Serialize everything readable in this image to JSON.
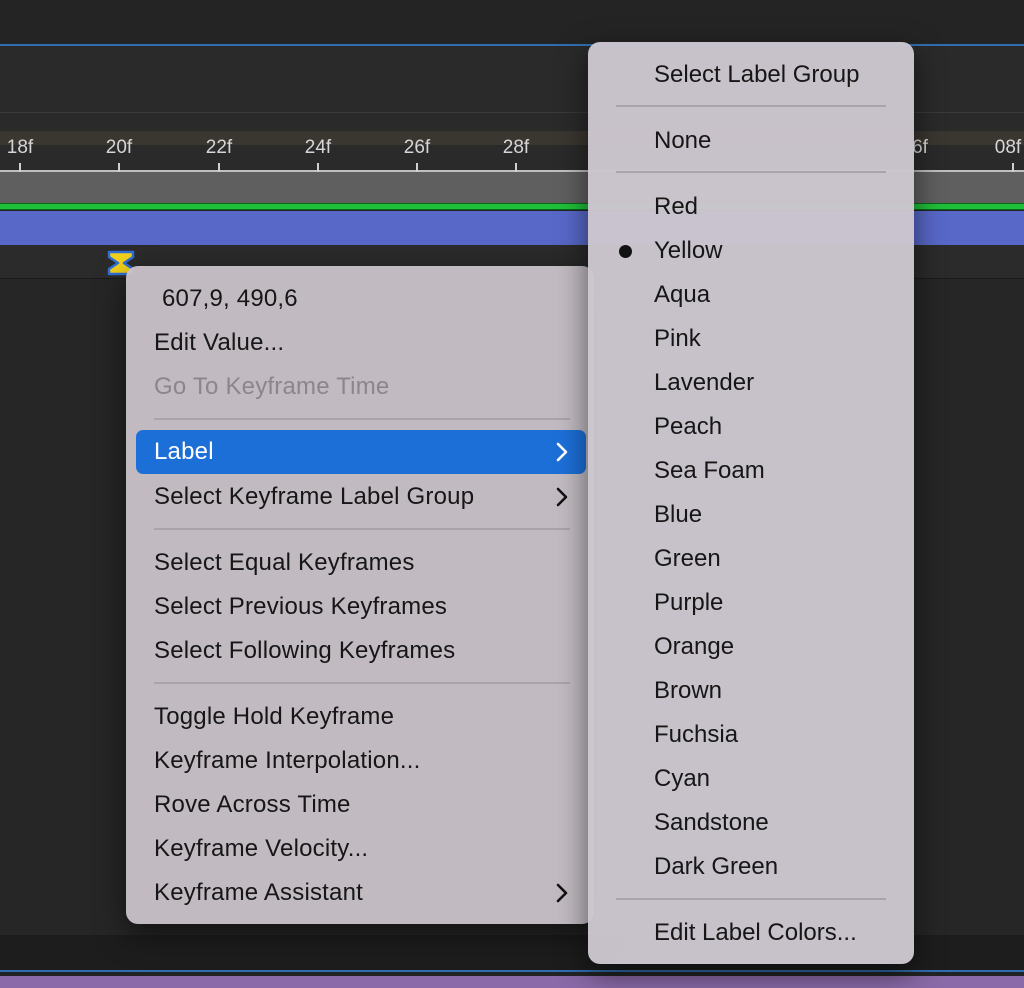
{
  "timeline": {
    "ticks": [
      "18f",
      "20f",
      "22f",
      "24f",
      "26f",
      "28f",
      "6f",
      "08f"
    ]
  },
  "context_menu": {
    "value_readout": "607,9, 490,6",
    "edit_value": "Edit Value...",
    "go_to_keyframe_time": "Go To Keyframe Time",
    "label": "Label",
    "select_keyframe_label_group": "Select Keyframe Label Group",
    "select_equal_keyframes": "Select Equal Keyframes",
    "select_previous_keyframes": "Select Previous Keyframes",
    "select_following_keyframes": "Select Following Keyframes",
    "toggle_hold_keyframe": "Toggle Hold Keyframe",
    "keyframe_interpolation": "Keyframe Interpolation...",
    "rove_across_time": "Rove Across Time",
    "keyframe_velocity": "Keyframe Velocity...",
    "keyframe_assistant": "Keyframe Assistant"
  },
  "label_menu": {
    "select_label_group": "Select Label Group",
    "none": "None",
    "selected": "Yellow",
    "colors": [
      "Red",
      "Yellow",
      "Aqua",
      "Pink",
      "Lavender",
      "Peach",
      "Sea Foam",
      "Blue",
      "Green",
      "Purple",
      "Orange",
      "Brown",
      "Fuchsia",
      "Cyan",
      "Sandstone",
      "Dark Green"
    ],
    "edit_label_colors": "Edit Label Colors..."
  },
  "colors": {
    "highlight": "#1d6fd8",
    "layer_bar": "#5868c8",
    "work_area_line": "#1fbf3a",
    "keyframe": "#f2d21b"
  }
}
